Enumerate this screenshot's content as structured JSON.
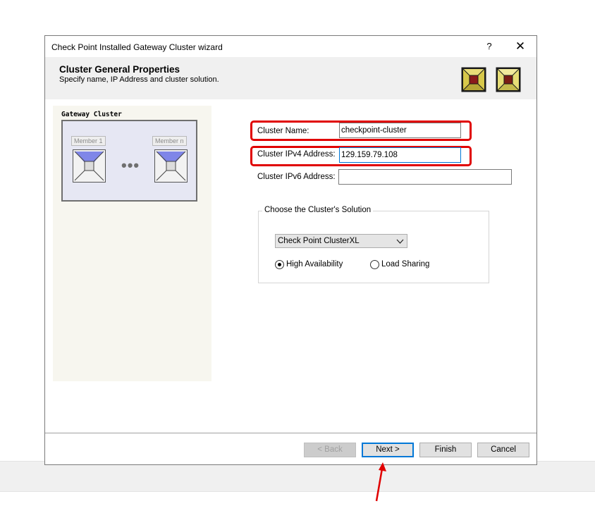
{
  "window": {
    "title": "Check Point Installed Gateway Cluster wizard",
    "help_glyph": "?",
    "close_glyph": "✕"
  },
  "header": {
    "title": "Cluster General Properties",
    "subtitle": "Specify name, IP Address and cluster solution.",
    "icons": [
      "gateway-cluster-icon",
      "gateway-icon"
    ]
  },
  "diagram": {
    "label": "Gateway Cluster",
    "member_1": "Member 1",
    "member_n": "Member n",
    "ellipsis": "•••"
  },
  "form": {
    "cluster_name_label": "Cluster Name:",
    "cluster_name_value": "checkpoint-cluster",
    "ipv4_label": "Cluster IPv4 Address:",
    "ipv4_value": "129.159.79.108",
    "ipv6_label": "Cluster IPv6 Address:",
    "ipv6_value": ""
  },
  "solution": {
    "legend": "Choose the Cluster's Solution",
    "selected": "Check Point ClusterXL",
    "options": [
      {
        "label": "High Availability",
        "checked": true
      },
      {
        "label": "Load Sharing",
        "checked": false
      }
    ]
  },
  "buttons": {
    "back": "< Back",
    "next": "Next >",
    "finish": "Finish",
    "cancel": "Cancel"
  },
  "colors": {
    "highlight": "#e00000",
    "focus": "#0078d7",
    "icon_fill": "#d7c84a",
    "icon_core": "#8b1a1a"
  }
}
